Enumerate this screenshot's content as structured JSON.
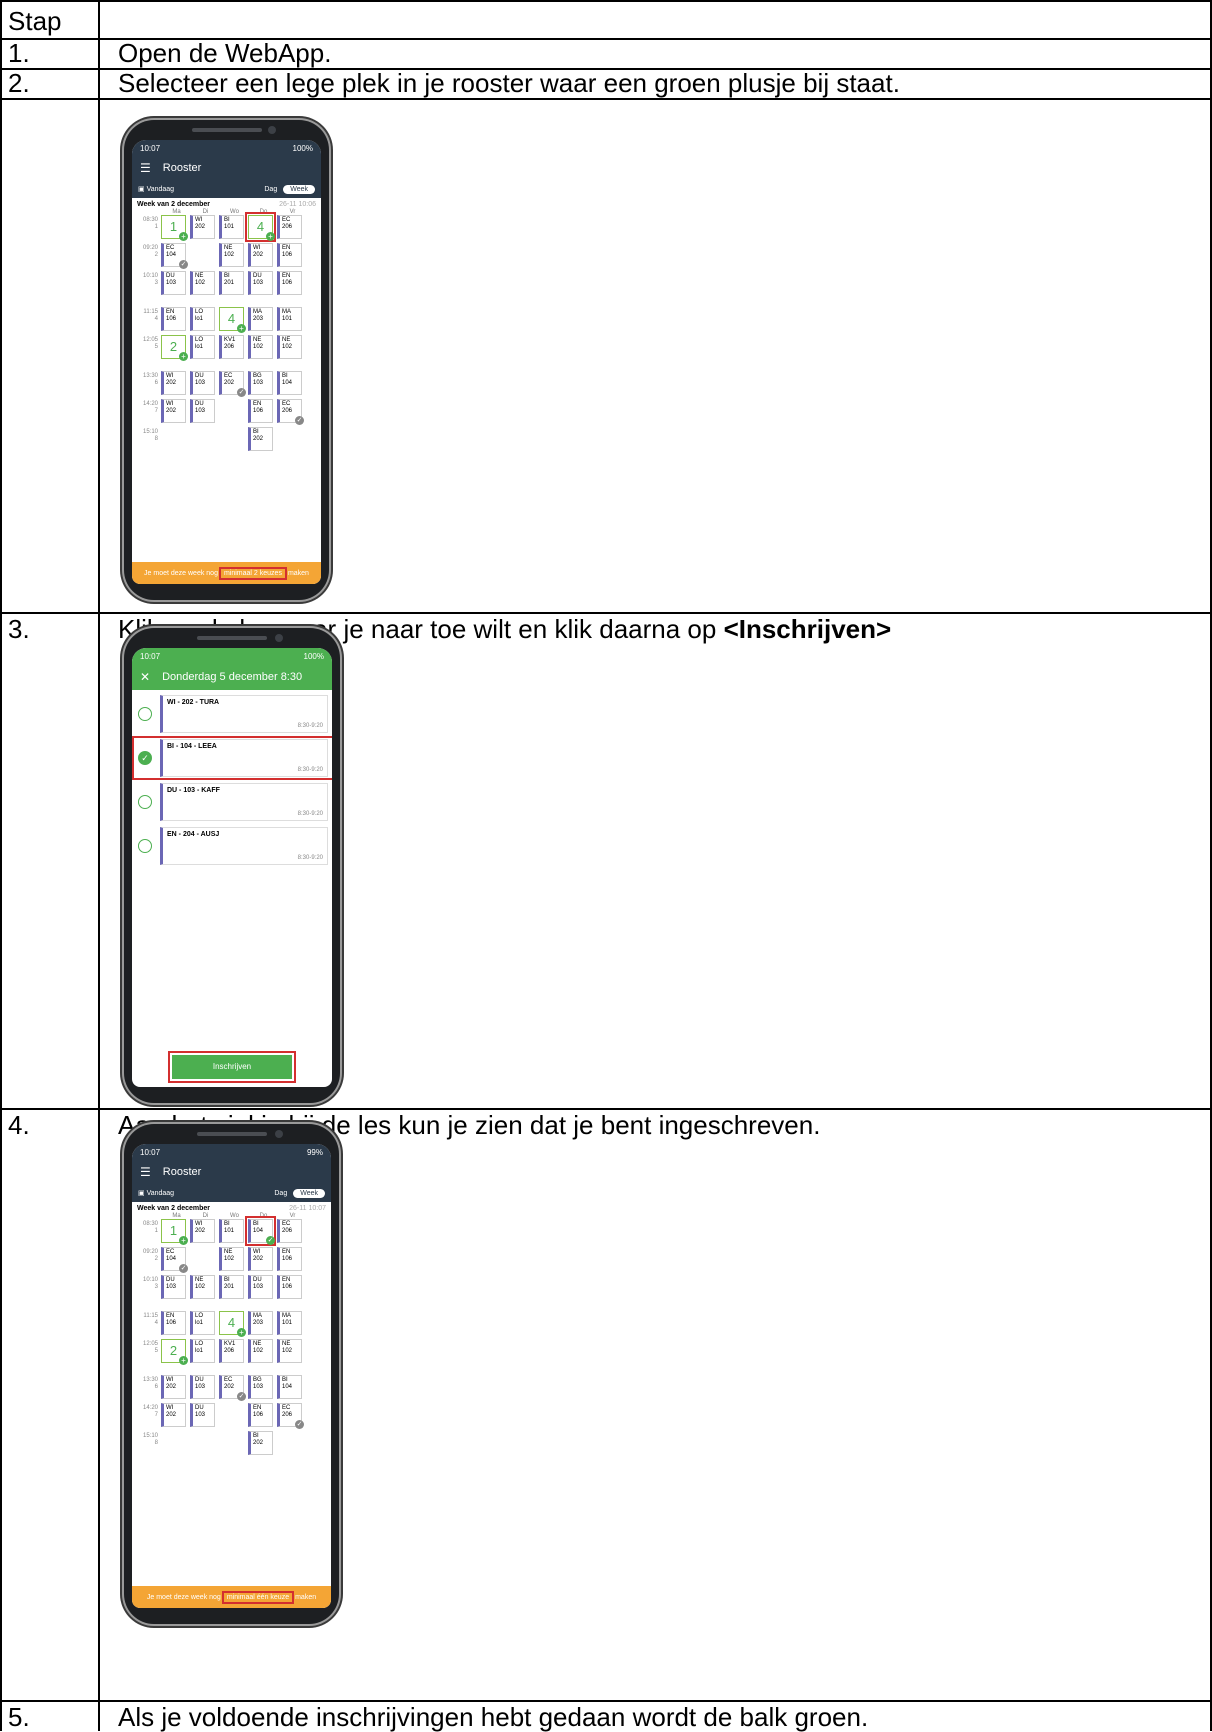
{
  "header": {
    "stap": "Stap"
  },
  "steps": [
    {
      "num": "1.",
      "text": "Open de WebApp."
    },
    {
      "num": "2.",
      "text": "Selecteer een lege plek in je rooster waar een groen plusje bij staat."
    },
    {
      "num": "3.",
      "text_before": "Klik op de les waar je naar toe wilt en klik daarna op ",
      "text_bold": "<Inschrijven>"
    },
    {
      "num": "4.",
      "text": "Aan het vinkje bij de les kun je zien dat je bent ingeschreven."
    },
    {
      "num": "5.",
      "text": "Als je voldoende inschrijvingen hebt gedaan wordt de balk groen."
    }
  ],
  "phone1": {
    "time": "10:07",
    "battery": "100%",
    "title": "Rooster",
    "today": "Vandaag",
    "view_day": "Dag",
    "view_week": "Week",
    "week_label": "Week van 2 december",
    "timestamp": "26-11 10:06",
    "days": [
      "Ma",
      "Di",
      "Wo",
      "Do",
      "Vr"
    ],
    "banner_a": "Je moet deze week nog",
    "banner_b": "minimaal 2 keuzes",
    "banner_c": "maken"
  },
  "phone2": {
    "time": "10:07",
    "battery": "100%",
    "title": "Donderdag 5 december 8:30",
    "options": [
      {
        "label": "WI - 202 - TURA",
        "time": "8:30-9:20",
        "selected": false
      },
      {
        "label": "BI - 104 - LEEA",
        "time": "8:30-9:20",
        "selected": true
      },
      {
        "label": "DU - 103 - KAFF",
        "time": "8:30-9:20",
        "selected": false
      },
      {
        "label": "EN - 204 - AUSJ",
        "time": "8:30-9:20",
        "selected": false
      }
    ],
    "button": "Inschrijven"
  },
  "phone3": {
    "time": "10:07",
    "battery": "99%",
    "title": "Rooster",
    "today": "Vandaag",
    "view_day": "Dag",
    "view_week": "Week",
    "week_label": "Week van 2 december",
    "timestamp": "26-11 10:07",
    "days": [
      "Ma",
      "Di",
      "Wo",
      "Do",
      "Vr"
    ],
    "banner_a": "Je moet deze week nog",
    "banner_b": "minimaal één keuze",
    "banner_c": "maken"
  },
  "schedule": {
    "rows": [
      {
        "time": "08:30",
        "hour": "1",
        "cells": [
          "pick:1",
          "WI|202",
          "BI|101",
          "pick:4",
          "EC|206"
        ]
      },
      {
        "time": "09:20",
        "hour": "2",
        "cells": [
          "EC|104|chk",
          "",
          "NE|102",
          "WI|202",
          "EN|106"
        ]
      },
      {
        "time": "10:10",
        "hour": "3",
        "cells": [
          "DU|103",
          "NE|102",
          "BI|201",
          "DU|103",
          "EN|106"
        ]
      },
      {
        "time": "11:15",
        "hour": "4",
        "cells": [
          "EN|106",
          "LO|lo1",
          "pick:4",
          "MA|203",
          "MA|101"
        ]
      },
      {
        "time": "12:05",
        "hour": "5",
        "cells": [
          "pick:2",
          "LO|lo1",
          "KV1|206",
          "NE|102",
          "NE|102"
        ]
      },
      {
        "time": "13:30",
        "hour": "6",
        "cells": [
          "WI|202",
          "DU|103",
          "EC|202|chk",
          "BG|103",
          "BI|104"
        ]
      },
      {
        "time": "14:20",
        "hour": "7",
        "cells": [
          "WI|202",
          "DU|103",
          "",
          "EN|106",
          "EC|206|chk"
        ]
      },
      {
        "time": "15:10",
        "hour": "8",
        "cells": [
          "",
          "",
          "",
          "BI|202",
          ""
        ]
      }
    ],
    "row_after_3": "BI|104|chkg"
  },
  "colors": {
    "accent_green": "#4caf50",
    "header_dark": "#2b3a4a",
    "banner_orange": "#f4a535",
    "highlight_red": "#d32f2f",
    "lesson_bar": "#6b67b5"
  }
}
